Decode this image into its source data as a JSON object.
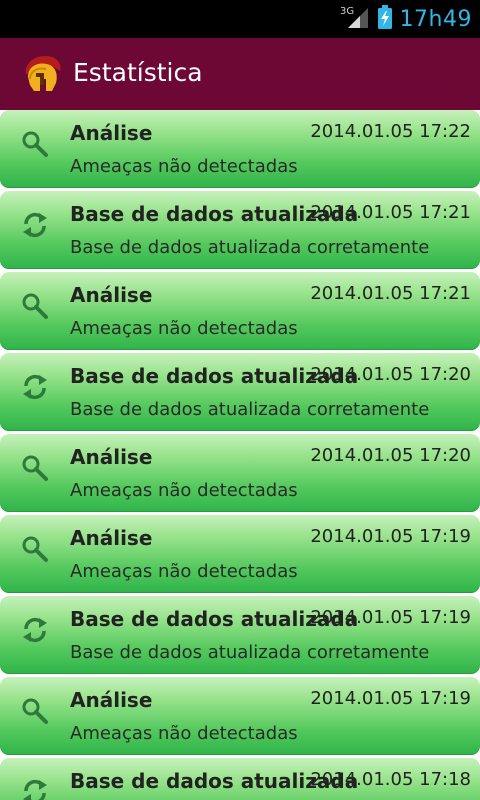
{
  "status_bar": {
    "network": "3G",
    "time": "17h49"
  },
  "app_bar": {
    "title": "Estatística",
    "logo_icon": "spartan-helmet-icon"
  },
  "colors": {
    "status_bar_bg": "#000000",
    "app_bar_bg": "#6d0734",
    "clock": "#33b5e5",
    "item_top": "#c6f1bb",
    "item_bottom": "#2fb44a"
  },
  "list": {
    "items": [
      {
        "type": "scan",
        "icon": "search-icon",
        "title": "Análise",
        "time": "2014.01.05 17:22",
        "description": "Ameaças não detectadas"
      },
      {
        "type": "update",
        "icon": "refresh-icon",
        "title": "Base de dados atualizada",
        "time": "2014.01.05 17:21",
        "description": "Base de dados atualizada corretamente"
      },
      {
        "type": "scan",
        "icon": "search-icon",
        "title": "Análise",
        "time": "2014.01.05 17:21",
        "description": "Ameaças não detectadas"
      },
      {
        "type": "update",
        "icon": "refresh-icon",
        "title": "Base de dados atualizada",
        "time": "2014.01.05 17:20",
        "description": "Base de dados atualizada corretamente"
      },
      {
        "type": "scan",
        "icon": "search-icon",
        "title": "Análise",
        "time": "2014.01.05 17:20",
        "description": "Ameaças não detectadas"
      },
      {
        "type": "scan",
        "icon": "search-icon",
        "title": "Análise",
        "time": "2014.01.05 17:19",
        "description": "Ameaças não detectadas"
      },
      {
        "type": "update",
        "icon": "refresh-icon",
        "title": "Base de dados atualizada",
        "time": "2014.01.05 17:19",
        "description": "Base de dados atualizada corretamente"
      },
      {
        "type": "scan",
        "icon": "search-icon",
        "title": "Análise",
        "time": "2014.01.05 17:19",
        "description": "Ameaças não detectadas"
      },
      {
        "type": "update",
        "icon": "refresh-icon",
        "title": "Base de dados atualizada",
        "time": "2014.01.05 17:18",
        "description": ""
      }
    ]
  }
}
